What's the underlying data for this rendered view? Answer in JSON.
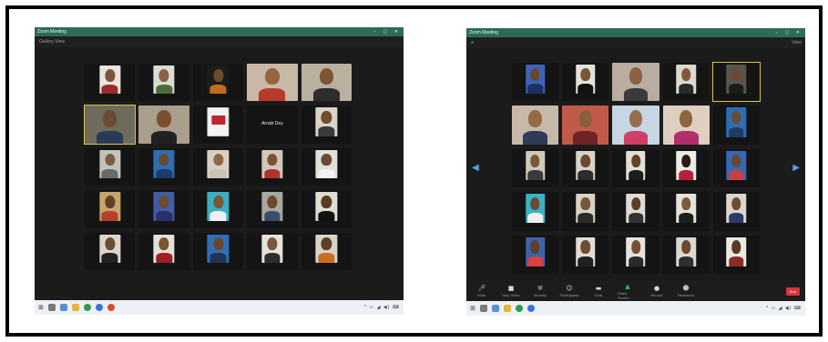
{
  "left": {
    "title": "Zoom Meeting",
    "view": "Gallery View",
    "tiles": [
      {
        "name": "",
        "hand": true,
        "photo": "portrait",
        "skin": "#7a5538",
        "bg": "#e9e5dd",
        "cloth": "#9b2b2b"
      },
      {
        "name": "",
        "hand": true,
        "photo": "portrait",
        "skin": "#8a6041",
        "bg": "#dcdcd6",
        "cloth": "#4f6d3a"
      },
      {
        "name": "",
        "hand": true,
        "photo": "portrait",
        "skin": "#6c4a2c",
        "bg": "#1c1c1c",
        "cloth": "#c46b1a"
      },
      {
        "name": "",
        "hand": false,
        "photo": "wide",
        "skin": "#94653f",
        "bg": "#c9b8a5",
        "cloth": "#b83a2a"
      },
      {
        "name": "",
        "hand": false,
        "photo": "wide",
        "skin": "#7d5434",
        "bg": "#b9b0a0",
        "cloth": "#2d2d2d"
      },
      {
        "name": "",
        "hand": false,
        "photo": "wide",
        "skin": "#6b4a33",
        "bg": "#6e6b5d",
        "cloth": "#2a3a55",
        "active": true
      },
      {
        "name": "",
        "hand": false,
        "photo": "wide",
        "skin": "#7a5030",
        "bg": "#aa9e8c",
        "cloth": "#212121"
      },
      {
        "name": "",
        "hand": false,
        "photo": "logo",
        "skin": "#c0262e",
        "bg": "#f4f4f4",
        "cloth": "#c0262e"
      },
      {
        "name": "",
        "hand": false,
        "photo": "text",
        "text": "Arnab Dey",
        "bg": "#141414"
      },
      {
        "name": "",
        "hand": false,
        "photo": "portrait",
        "skin": "#714d31",
        "bg": "#dad5c9",
        "cloth": "#3a3a3a"
      },
      {
        "name": "",
        "hand": false,
        "photo": "portrait",
        "skin": "#7f5a3b",
        "bg": "#bfc4bf",
        "cloth": "#6a6a6a"
      },
      {
        "name": "",
        "hand": false,
        "photo": "portrait",
        "skin": "#6a482e",
        "bg": "#2c6fb0",
        "cloth": "#1e3a6c"
      },
      {
        "name": "",
        "hand": false,
        "photo": "portrait",
        "skin": "#8b6647",
        "bg": "#d7cfc1",
        "cloth": "#c9c2b5"
      },
      {
        "name": "",
        "hand": false,
        "photo": "portrait",
        "skin": "#7c5030",
        "bg": "#cfc8bb",
        "cloth": "#b52f2f"
      },
      {
        "name": "",
        "hand": false,
        "photo": "portrait",
        "skin": "#6b4a33",
        "bg": "#e1e1db",
        "cloth": "#f2f2f2"
      },
      {
        "name": "",
        "hand": false,
        "photo": "portrait",
        "skin": "#5f4028",
        "bg": "#c7a46c",
        "cloth": "#b83d2a"
      },
      {
        "name": "",
        "hand": false,
        "photo": "portrait",
        "skin": "#6c4a30",
        "bg": "#3f5ea6",
        "cloth": "#2a2f6a"
      },
      {
        "name": "",
        "hand": false,
        "photo": "portrait",
        "skin": "#7a5636",
        "bg": "#3ab0c4",
        "cloth": "#f0f0f0"
      },
      {
        "name": "",
        "hand": false,
        "photo": "portrait",
        "skin": "#6a482c",
        "bg": "#a8a7a0",
        "cloth": "#3b4b6e"
      },
      {
        "name": "",
        "hand": false,
        "photo": "portrait",
        "skin": "#5b3d25",
        "bg": "#e0ddd4",
        "cloth": "#111111"
      },
      {
        "name": "",
        "hand": false,
        "photo": "portrait",
        "skin": "#6f4c30",
        "bg": "#dbd7ce",
        "cloth": "#222222"
      },
      {
        "name": "",
        "hand": false,
        "photo": "portrait",
        "skin": "#7b5536",
        "bg": "#e3e0d8",
        "cloth": "#9c1f24"
      },
      {
        "name": "",
        "hand": false,
        "photo": "portrait",
        "skin": "#6a472c",
        "bg": "#2e6fb7",
        "cloth": "#223355"
      },
      {
        "name": "",
        "hand": false,
        "photo": "portrait",
        "skin": "#7c5838",
        "bg": "#e6e3dc",
        "cloth": "#2d2d2d"
      },
      {
        "name": "",
        "hand": false,
        "photo": "portrait",
        "skin": "#5e3e26",
        "bg": "#d9d4ca",
        "cloth": "#c96e22"
      }
    ]
  },
  "right": {
    "title": "Zoom Meeting",
    "view": "View",
    "tiles": [
      {
        "name": "",
        "hand": true,
        "photo": "portrait",
        "skin": "#6a472c",
        "bg": "#3c63b8",
        "cloth": "#1f2f66"
      },
      {
        "name": "",
        "hand": false,
        "photo": "portrait",
        "skin": "#7a5637",
        "bg": "#e4e1da",
        "cloth": "#111111"
      },
      {
        "name": "",
        "hand": false,
        "photo": "wide",
        "skin": "#8a6143",
        "bg": "#b8ada0",
        "cloth": "#3a3a3a"
      },
      {
        "name": "",
        "hand": false,
        "photo": "portrait",
        "skin": "#80593a",
        "bg": "#ddd9d0",
        "cloth": "#2a2a2a"
      },
      {
        "name": "",
        "hand": false,
        "photo": "portrait",
        "skin": "#6a4a30",
        "bg": "#5a554d",
        "cloth": "#1b1b1b",
        "active": true
      },
      {
        "name": "",
        "hand": false,
        "photo": "wide",
        "skin": "#946a47",
        "bg": "#c7b9a9",
        "cloth": "#2f3b58"
      },
      {
        "name": "",
        "hand": false,
        "photo": "wide",
        "skin": "#8a5f3d",
        "bg": "#c25a4a",
        "cloth": "#6d2424"
      },
      {
        "name": "",
        "hand": false,
        "photo": "wide",
        "skin": "#96704d",
        "bg": "#c6d6e2",
        "cloth": "#cf3f6a"
      },
      {
        "name": "",
        "hand": false,
        "photo": "wide",
        "skin": "#8d6442",
        "bg": "#dfcfc0",
        "cloth": "#b0306a"
      },
      {
        "name": "",
        "hand": false,
        "photo": "portrait",
        "skin": "#6a4a30",
        "bg": "#2f6db1",
        "cloth": "#203a66"
      },
      {
        "name": "",
        "hand": false,
        "photo": "portrait",
        "skin": "#7a5738",
        "bg": "#cfc8bb",
        "cloth": "#3a3a3a"
      },
      {
        "name": "",
        "hand": false,
        "photo": "portrait",
        "skin": "#6c4a2f",
        "bg": "#d8d3c8",
        "cloth": "#2c2c2c"
      },
      {
        "name": "",
        "hand": false,
        "photo": "portrait",
        "skin": "#634328",
        "bg": "#e2dfd8",
        "cloth": "#1c1c1c"
      },
      {
        "name": "",
        "hand": false,
        "photo": "portrait",
        "skin": "#2b1d14",
        "bg": "#ecebe6",
        "cloth": "#b8203a"
      },
      {
        "name": "",
        "hand": false,
        "photo": "portrait",
        "skin": "#6a482d",
        "bg": "#3567b8",
        "cloth": "#c84040"
      },
      {
        "name": "",
        "hand": false,
        "photo": "portrait",
        "skin": "#6b4b31",
        "bg": "#39b2c7",
        "cloth": "#f0f0f0"
      },
      {
        "name": "",
        "hand": false,
        "photo": "portrait",
        "skin": "#79563a",
        "bg": "#d7d2c6",
        "cloth": "#2a2a2a"
      },
      {
        "name": "",
        "hand": false,
        "photo": "portrait",
        "skin": "#5d3f27",
        "bg": "#dedbd3",
        "cloth": "#333333"
      },
      {
        "name": "",
        "hand": false,
        "photo": "portrait",
        "skin": "#7e5a3a",
        "bg": "#e5e2db",
        "cloth": "#1d1d1d"
      },
      {
        "name": "",
        "hand": false,
        "photo": "portrait",
        "skin": "#6d4c30",
        "bg": "#dad6cd",
        "cloth": "#2b3a66"
      },
      {
        "name": "",
        "hand": false,
        "photo": "portrait",
        "skin": "#5f4129",
        "bg": "#3e62ad",
        "cloth": "#d94040"
      },
      {
        "name": "",
        "hand": false,
        "photo": "portrait",
        "skin": "#6f4d31",
        "bg": "#e1ddd5",
        "cloth": "#202020"
      },
      {
        "name": "",
        "hand": false,
        "photo": "portrait",
        "skin": "#735034",
        "bg": "#e6e3dd",
        "cloth": "#2a2a2a"
      },
      {
        "name": "",
        "hand": false,
        "photo": "portrait",
        "skin": "#6a492e",
        "bg": "#dcd8cf",
        "cloth": "#2e2e2e"
      },
      {
        "name": "",
        "hand": false,
        "photo": "portrait",
        "skin": "#5a3c25",
        "bg": "#ece9e2",
        "cloth": "#8a2a2a"
      }
    ],
    "controls": [
      "Mute",
      "Stop Video",
      "Security",
      "Participants",
      "Chat",
      "Share Screen",
      "Record",
      "Reactions"
    ],
    "end": "End"
  },
  "colors": {
    "zoom_bg": "#1b1b1b",
    "title_bar": "#2d6a5a",
    "active_speaker": "#d9c44a",
    "taskbar": "#edf1f6",
    "end_button": "#d6343a"
  },
  "icons": {
    "raised_hand": "raised-hand-icon",
    "mic": "mic-icon",
    "video": "video-icon",
    "share": "share-screen-icon",
    "windows_start": "windows-logo-icon"
  }
}
